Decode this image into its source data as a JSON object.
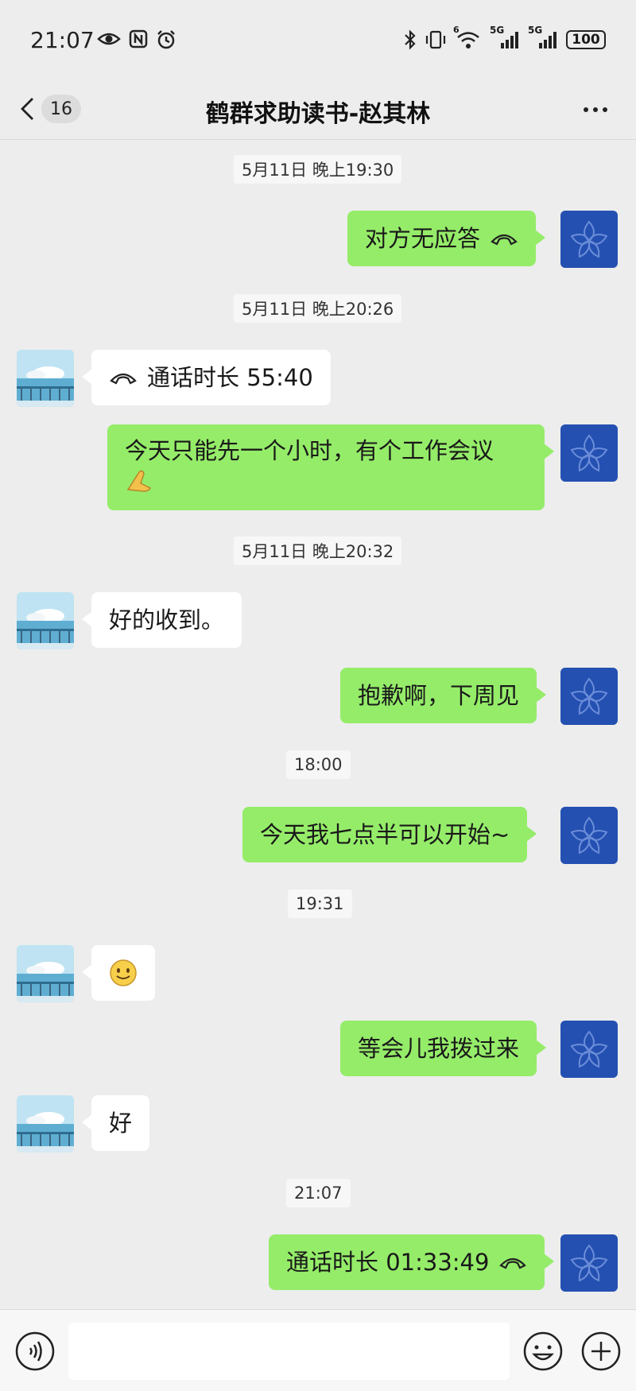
{
  "status_bar": {
    "time": "21:07",
    "battery": "100",
    "icons": [
      "eye-icon",
      "nfc-icon",
      "alarm-icon",
      "bluetooth-icon",
      "vibrate-icon",
      "wifi-6-icon",
      "5g-signal-icon",
      "5g-signal-icon",
      "battery-icon"
    ],
    "network_labels": [
      "6",
      "5G",
      "5G"
    ]
  },
  "header": {
    "unread_count": "16",
    "title": "鹤群求助读书-赵其林",
    "icons": [
      "back-chevron-icon",
      "more-dots-icon"
    ]
  },
  "colors": {
    "background": "#ededed",
    "sent_bubble": "#95ec69",
    "received_bubble": "#ffffff",
    "self_avatar": "#2450b2"
  },
  "messages": [
    {
      "type": "timestamp",
      "text": "5月11日 晚上19:30"
    },
    {
      "type": "sent",
      "text": "对方无应答",
      "icon": "phone-handset-icon"
    },
    {
      "type": "timestamp",
      "text": "5月11日 晚上20:26"
    },
    {
      "type": "received",
      "text": "通话时长 55:40",
      "icon": "phone-handset-icon"
    },
    {
      "type": "sent",
      "text": "今天只能先一个小时，有个工作会议",
      "icon": "pray-hands-emoji"
    },
    {
      "type": "timestamp",
      "text": "5月11日 晚上20:32"
    },
    {
      "type": "received",
      "text": "好的收到。"
    },
    {
      "type": "sent",
      "text": "抱歉啊，下周见"
    },
    {
      "type": "timestamp",
      "text": "18:00"
    },
    {
      "type": "sent",
      "text": "今天我七点半可以开始~"
    },
    {
      "type": "timestamp",
      "text": "19:31"
    },
    {
      "type": "received",
      "text": "",
      "icon": "smile-emoji"
    },
    {
      "type": "sent",
      "text": "等会儿我拨过来"
    },
    {
      "type": "received",
      "text": "好"
    },
    {
      "type": "timestamp",
      "text": "21:07"
    },
    {
      "type": "sent",
      "text": "通话时长 01:33:49",
      "icon": "phone-handset-icon"
    }
  ],
  "input_bar": {
    "icons": [
      "voice-icon",
      "emoji-icon",
      "plus-icon"
    ],
    "value": ""
  }
}
